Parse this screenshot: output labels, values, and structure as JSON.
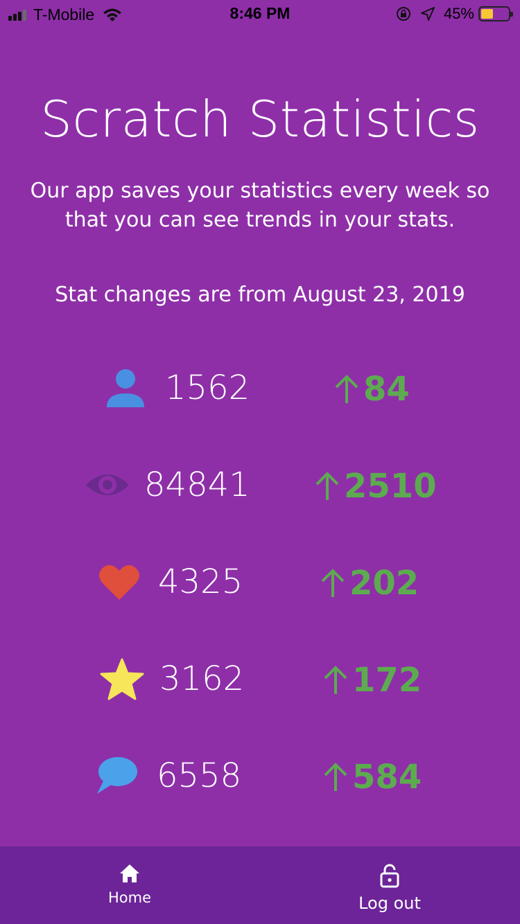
{
  "status_bar": {
    "carrier": "T-Mobile",
    "time": "8:46 PM",
    "battery": "45%",
    "icons": [
      "signal-icon",
      "wifi-icon",
      "orientation-lock-icon",
      "location-icon",
      "battery-icon"
    ]
  },
  "header": {
    "title": "Scratch Statistics",
    "subtitle": "Our app saves your statistics every week so that you can see trends in your stats.",
    "changes_note": "Stat changes are from August 23, 2019"
  },
  "stats": [
    {
      "icon": "followers-icon",
      "value": "1562",
      "change": "84",
      "color": "#4a90e2"
    },
    {
      "icon": "views-icon",
      "value": "84841",
      "change": "2510",
      "color": "#6a2a8e"
    },
    {
      "icon": "loves-icon",
      "value": "4325",
      "change": "202",
      "color": "#e04e3c"
    },
    {
      "icon": "favorites-icon",
      "value": "3162",
      "change": "172",
      "color": "#f7e55a"
    },
    {
      "icon": "comments-icon",
      "value": "6558",
      "change": "584",
      "color": "#4aa3ea"
    }
  ],
  "colors": {
    "background": "#8e2fa8",
    "nav_background": "#6c2498",
    "increase": "#5cac4f"
  },
  "nav": {
    "home_label": "Home",
    "logout_label": "Log out"
  }
}
